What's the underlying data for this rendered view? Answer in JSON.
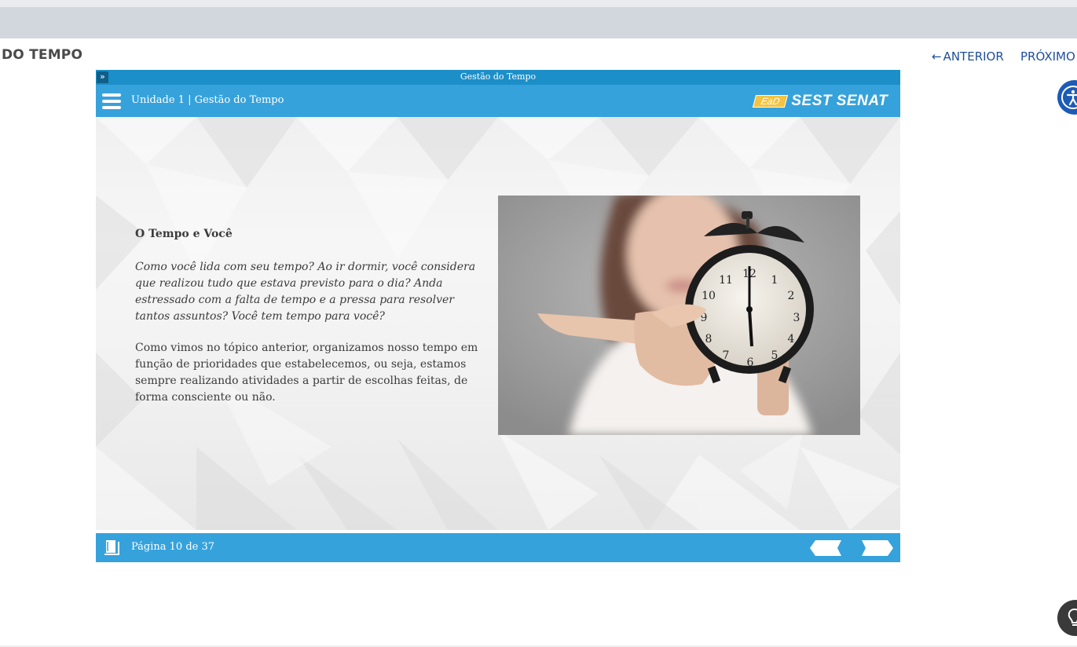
{
  "page": {
    "title": "DO TEMPO",
    "nav": {
      "prev_arrow": "←",
      "prev_label": "ANTERIOR",
      "next_label": "PRÓXIMO"
    }
  },
  "player": {
    "window_title": "Gestão do Tempo",
    "expand_glyph": "»",
    "header": {
      "unit_title": "Unidade 1 | Gestão do Tempo",
      "logo": {
        "ead": "EaD",
        "text": "SEST SENAT"
      }
    },
    "slide": {
      "heading": "O Tempo e Você",
      "italic_paragraph": "Como você lida com seu tempo? Ao ir dormir, você considera que realizou tudo que estava previsto para o dia? Anda estressado com a falta de tempo e a pressa para resolver tantos assuntos? Você tem tempo para você?",
      "body_paragraph": "Como vimos no tópico anterior, organizamos nosso tempo em função de prioridades que estabelecemos, ou seja, estamos sempre realizando atividades a partir de escolhas feitas, de forma consciente ou não."
    },
    "footer": {
      "page_counter": "Página 10 de 37"
    }
  },
  "colors": {
    "player_blue": "#36a2dc",
    "titlebar_blue": "#1c8fc9",
    "nav_link": "#1f4f9c",
    "accessibility": "#1c5bb6",
    "logo_ead": "#f5c342"
  },
  "icons": [
    "menu-icon",
    "book-icon",
    "expand-icon",
    "arrow-left-icon",
    "arrow-right-icon",
    "accessibility-icon",
    "lightbulb-icon",
    "alarm-clock-photo"
  ]
}
